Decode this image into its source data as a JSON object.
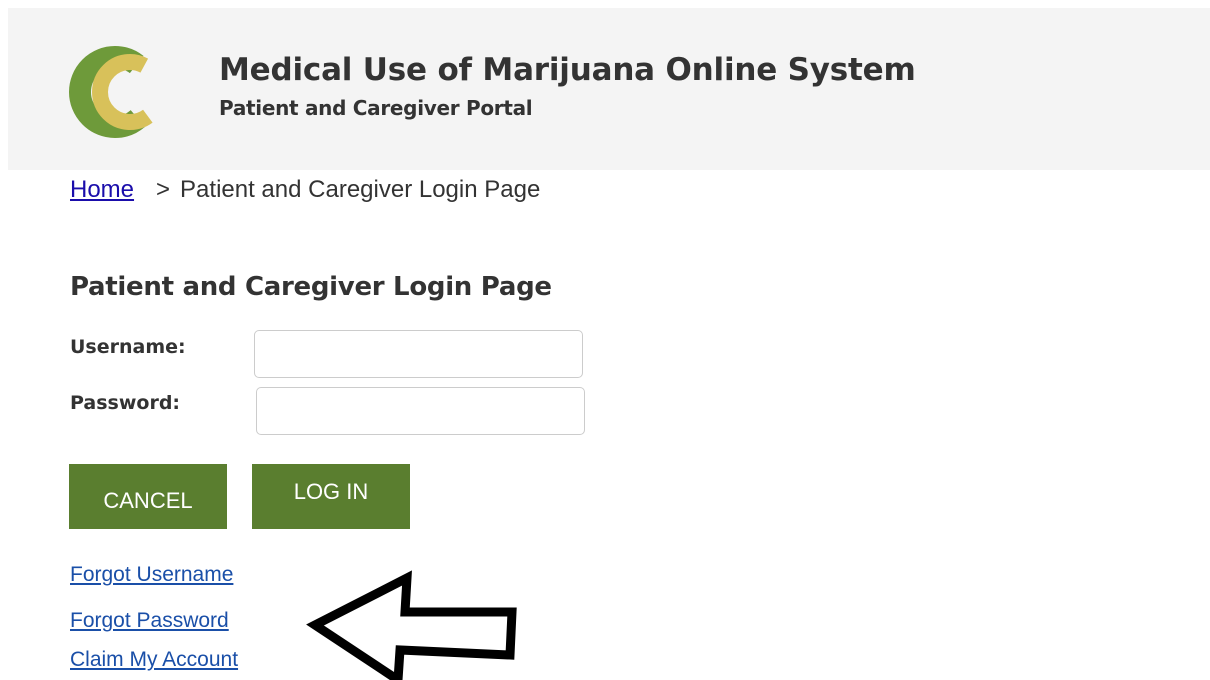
{
  "header": {
    "logo_icon": "portal-logo-icon",
    "title": "Medical Use of Marijuana Online System",
    "subtitle": "Patient and Caregiver Portal",
    "colors": {
      "background": "#f4f4f4",
      "logo_green": "#6e9a3a",
      "logo_yellow": "#d8c15a"
    }
  },
  "breadcrumb": {
    "home_label": "Home",
    "separator": ">",
    "current": "Patient and Caregiver Login Page"
  },
  "login": {
    "title": "Patient and Caregiver Login Page",
    "username_label": "Username:",
    "username_value": "",
    "password_label": "Password:",
    "password_value": "",
    "cancel_label": "CANCEL",
    "login_label": "LOG IN",
    "button_color": "#5a7e2f"
  },
  "links": {
    "forgot_username": "Forgot Username",
    "forgot_password": "Forgot Password",
    "claim_account": "Claim My Account",
    "color": "#1a4fa8"
  },
  "annotation": {
    "icon": "arrow-left-outline-icon"
  }
}
